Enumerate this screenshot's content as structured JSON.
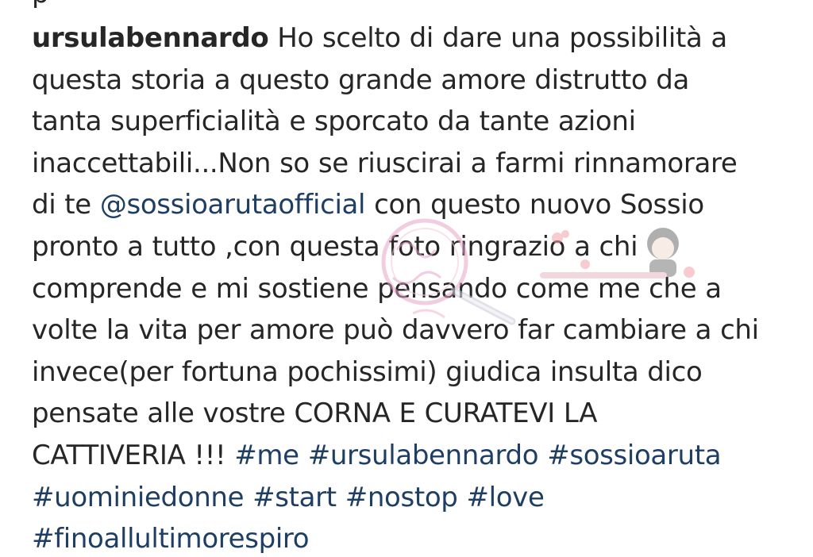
{
  "header": {
    "cropped_text": "p"
  },
  "post": {
    "username": "ursulabennardo",
    "lines": [
      "Ho scelto di dare una possibilità a",
      "questa storia a questo grande amore distrutto da",
      "tanta superficialità e sporcato da tante azioni",
      "inaccettabili...Non so se riuscirai a farmi rinnamorare",
      "di te"
    ],
    "mention": "@sossioarutaofficial",
    "after_mention": "con questo nuovo Sossio",
    "lines2": [
      "pronto a tutto ,con questa foto ringrazio a chi",
      "comprende e mi sostiene pensando come me che a",
      "volte la vita per amore può davvero far cambiare a chi",
      "invece(per fortuna pochissimi) giudica insulta dico",
      "pensate  alle vostre CORNA E CURATEVI LA",
      "CATTIVERIA !!!"
    ],
    "hashtags": [
      "#me",
      "#ursulabennardo",
      "#sossioaruta",
      "#uominiedonne",
      "#start",
      "#nostop",
      "#love",
      "#finoallultimorespiro"
    ]
  },
  "colors": {
    "text": "#262626",
    "link": "#1f3e64",
    "watermark_pink": "#e8a3c6"
  },
  "watermark": {
    "icon": "magnifier-logo-watermark"
  }
}
